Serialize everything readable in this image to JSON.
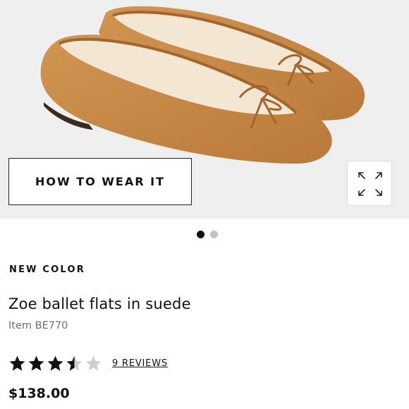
{
  "product_image": {
    "alt_subject": "tan suede ballet flats",
    "color": "#c98a48"
  },
  "buttons": {
    "how_to_wear": "HOW TO WEAR IT",
    "expand_icon": "expand-arrows-icon"
  },
  "carousel": {
    "total": 2,
    "active_index": 1
  },
  "product": {
    "badge": "NEW COLOR",
    "name": "Zoe ballet flats in suede",
    "item": "Item BE770",
    "rating": 3.5,
    "rating_max": 5,
    "reviews_label": "9 REVIEWS",
    "price": "$138.00"
  },
  "colors": {
    "hero_bg": "#efefef",
    "text": "#111111",
    "muted": "#6f6f6f",
    "star_filled": "#111111",
    "star_empty": "#cfcfcf"
  }
}
